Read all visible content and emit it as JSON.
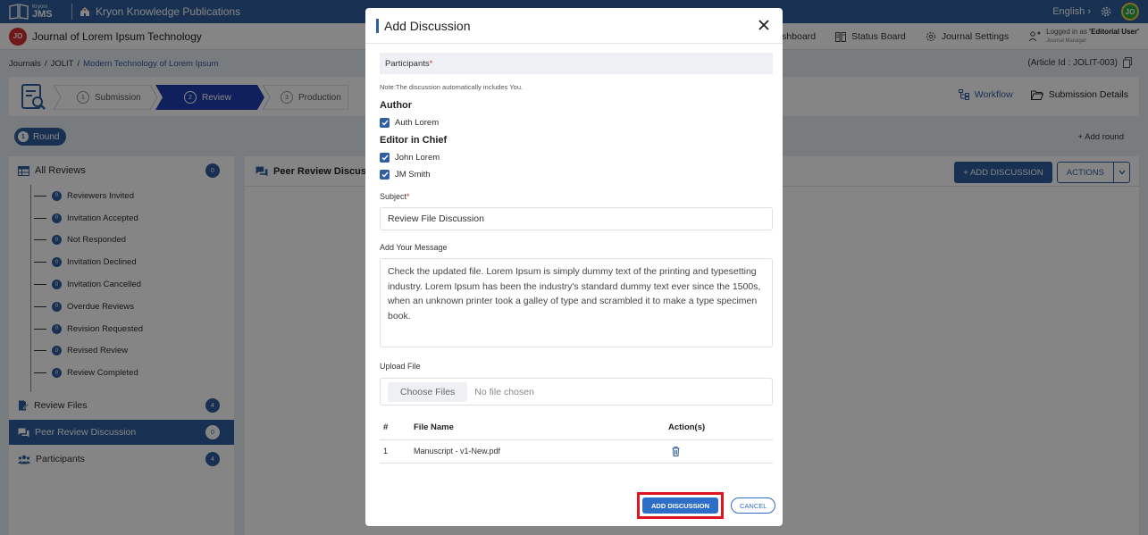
{
  "topbar": {
    "logo_small": "Kryoni",
    "logo_big": "JMS",
    "org_name": "Kryon Knowledge Publications",
    "language": "English",
    "user_initials": "JO"
  },
  "journal_bar": {
    "badge": "JO",
    "journal_name": "Journal of Lorem Ipsum Technology",
    "nav": {
      "dashboard_partial": "shboard",
      "status_board": "Status Board",
      "journal_settings": "Journal Settings"
    },
    "login_prefix": "Logged in as ",
    "login_user": "'Editorial User'",
    "login_role": "Journal Manager"
  },
  "breadcrumb": {
    "journals": "Journals",
    "sep": "/",
    "abbr": "JOLIT",
    "article": "Modern Technology of Lorem Ipsum",
    "article_id": "(Article Id : JOLIT-003)"
  },
  "workflow": {
    "steps": [
      {
        "num": "1",
        "label": "Submission"
      },
      {
        "num": "2",
        "label": "Review"
      },
      {
        "num": "3",
        "label": "Production"
      }
    ],
    "workflow_link": "Workflow",
    "submission_details": "Submission Details"
  },
  "round": {
    "num": "1",
    "label": "Round",
    "add_round": "+ Add round"
  },
  "sidebar": {
    "all_reviews": {
      "label": "All Reviews",
      "count": "0"
    },
    "tree": [
      {
        "label": "Reviewers Invited",
        "count": "0"
      },
      {
        "label": "Invitation Accepted",
        "count": "0"
      },
      {
        "label": "Not Responded",
        "count": "0"
      },
      {
        "label": "Invitation Declined",
        "count": "0"
      },
      {
        "label": "Invitation Cancelled",
        "count": "0"
      },
      {
        "label": "Overdue Reviews",
        "count": "0"
      },
      {
        "label": "Revision Requested",
        "count": "0"
      },
      {
        "label": "Revised Review",
        "count": "0"
      },
      {
        "label": "Review Completed",
        "count": "0"
      }
    ],
    "review_files": {
      "label": "Review Files",
      "count": "4"
    },
    "peer_review": {
      "label": "Peer Review Discussion",
      "count": "0"
    },
    "participants": {
      "label": "Participants",
      "count": "4"
    }
  },
  "main": {
    "title": "Peer Review Discuss",
    "add_discussion": "+ ADD DISCUSSION",
    "actions": "ACTIONS"
  },
  "modal": {
    "title": "Add Discussion",
    "participants_label": "Participants",
    "required_mark": "*",
    "note": "Note:The discussion automatically includes You.",
    "author_label": "Author",
    "authors": [
      "Auth Lorem"
    ],
    "editor_label": "Editor in Chief",
    "editors": [
      "John Lorem",
      "JM Smith"
    ],
    "subject_label": "Subject",
    "subject_value": "Review File Discussion",
    "message_label": "Add Your Message",
    "message_value": "Check the updated file. Lorem Ipsum is simply dummy text of the printing and typesetting industry. Lorem Ipsum has been the industry's standard dummy text ever since the 1500s, when an unknown printer took a galley of type and scrambled it to make a type specimen book.",
    "upload_label": "Upload File",
    "choose_files": "Choose Files",
    "no_file": "No file chosen",
    "table": {
      "headers": [
        "#",
        "File Name",
        "Action(s)"
      ],
      "rows": [
        {
          "num": "1",
          "file": "Manuscript - v1-New.pdf"
        }
      ]
    },
    "add_button": "ADD DISCUSSION",
    "cancel_button": "CANCEL"
  },
  "colors": {
    "brand": "#2f5fa0",
    "highlight": "#e0141e",
    "required": "#d32f2f"
  }
}
